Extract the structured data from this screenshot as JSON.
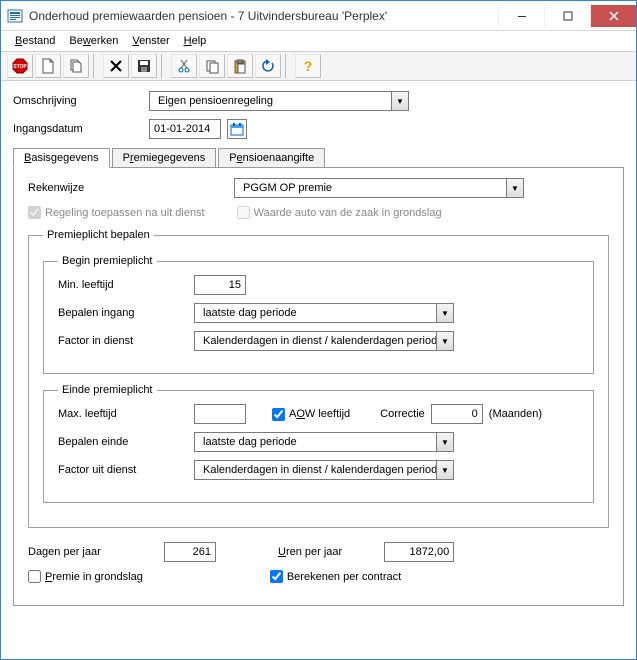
{
  "window": {
    "title": "Onderhoud premiewaarden pensioen - 7 Uitvindersbureau 'Perplex'"
  },
  "menu": {
    "bestand": "Bestand",
    "bewerken": "Bewerken",
    "venster": "Venster",
    "help": "Help"
  },
  "toolbar": {
    "stop": "stop-icon",
    "new": "new-icon",
    "copy_doc": "copy-doc-icon",
    "delete": "delete-icon",
    "save": "save-icon",
    "cut": "cut-icon",
    "copy": "copy-icon",
    "paste": "paste-icon",
    "undo": "undo-icon",
    "help": "help-icon"
  },
  "header": {
    "omschrijving_label": "Omschrijving",
    "omschrijving_value": "Eigen pensioenregeling",
    "ingangsdatum_label": "Ingangsdatum",
    "ingangsdatum_value": "01-01-2014"
  },
  "tabs": {
    "basis": "Basisgegevens",
    "premie": "Premiegegevens",
    "aangifte": "Pensioenaangifte"
  },
  "basis": {
    "rekenwijze_label": "Rekenwijze",
    "rekenwijze_value": "PGGM OP premie",
    "regeling_na_dienst": "Regeling toepassen na uit dienst",
    "waarde_auto": "Waarde auto van de zaak in grondslag",
    "premieplicht_legend": "Premieplicht bepalen",
    "begin_legend": "Begin premieplicht",
    "min_leeftijd_label": "Min. leeftijd",
    "min_leeftijd_value": "15",
    "bepalen_ingang_label": "Bepalen ingang",
    "bepalen_ingang_value": "laatste dag periode",
    "factor_in_label": "Factor in dienst",
    "factor_in_value": "Kalenderdagen in dienst / kalenderdagen periode",
    "einde_legend": "Einde premieplicht",
    "max_leeftijd_label": "Max. leeftijd",
    "max_leeftijd_value": "",
    "aow_leeftijd": "AOW leeftijd",
    "correctie_label": "Correctie",
    "correctie_value": "0",
    "correctie_unit": "(Maanden)",
    "bepalen_einde_label": "Bepalen einde",
    "bepalen_einde_value": "laatste dag periode",
    "factor_uit_label": "Factor uit dienst",
    "factor_uit_value": "Kalenderdagen in dienst / kalenderdagen periode",
    "dagen_label": "Dagen per jaar",
    "dagen_value": "261",
    "uren_label": "Uren per jaar",
    "uren_value": "1872,00",
    "premie_grondslag": "Premie in grondslag",
    "berekenen_contract": "Berekenen per contract"
  }
}
